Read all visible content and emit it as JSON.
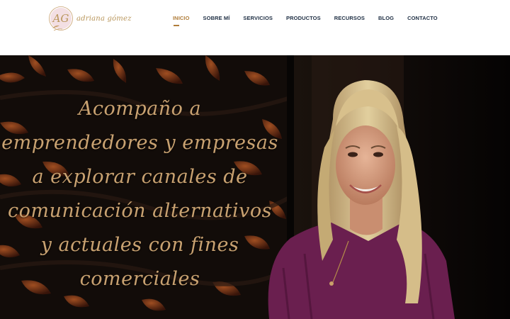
{
  "brand": {
    "monogram": "AG",
    "name": "adriana gómez"
  },
  "nav": {
    "items": [
      {
        "label": "INICIO",
        "active": true
      },
      {
        "label": "SOBRE MÍ",
        "active": false
      },
      {
        "label": "SERVICIOS",
        "active": false
      },
      {
        "label": "PRODUCTOS",
        "active": false
      },
      {
        "label": "RECURSOS",
        "active": false
      },
      {
        "label": "BLOG",
        "active": false
      },
      {
        "label": "CONTACTO",
        "active": false
      }
    ]
  },
  "hero": {
    "headline_lines": [
      "Acompaño a",
      "emprendedores y empresas",
      "a explorar canales de",
      "comunicación alternativos",
      "y actuales con fines",
      "comerciales"
    ],
    "image": "portrait of a smiling blonde woman in a purple blouse against a dark background with copper leaf pattern"
  },
  "colors": {
    "accent_gold": "#b07d3a",
    "nav_text": "#1f2f44",
    "headline": "#c9a271",
    "blouse": "#6a1f4f",
    "background_dark": "#0e0a08"
  }
}
